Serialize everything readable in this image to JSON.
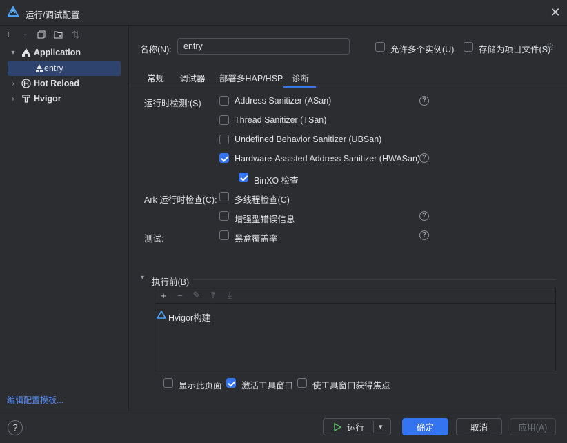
{
  "window": {
    "title": "运行/调试配置",
    "close_icon": "close-icon"
  },
  "toolbar": {
    "icons": [
      "add-icon",
      "remove-icon",
      "copy-icon",
      "folder-add-icon",
      "sort-icon"
    ]
  },
  "tree": {
    "items": [
      {
        "label": "Application",
        "expanded": true,
        "icon": "harmony-app-icon"
      },
      {
        "label": "entry",
        "selected": true,
        "icon": "harmony-module-icon"
      },
      {
        "label": "Hot Reload",
        "expanded": false,
        "icon": "hot-reload-icon"
      },
      {
        "label": "Hvigor",
        "expanded": false,
        "icon": "hvigor-icon"
      }
    ],
    "edit_templates": "编辑配置模板..."
  },
  "form": {
    "name_label": "名称(N):",
    "name_value": "entry",
    "allow_multiple": {
      "label": "允许多个实例(U)",
      "checked": false
    },
    "store_as_file": {
      "label": "存储为项目文件(S)",
      "checked": false
    },
    "tabs": [
      "常规",
      "调试器",
      "部署多HAP/HSP",
      "诊断"
    ],
    "active_tab": "诊断"
  },
  "diagnostics": {
    "runtime_label": "运行时检测:(S)",
    "asan": {
      "label": "Address Sanitizer (ASan)",
      "checked": false
    },
    "tsan": {
      "label": "Thread Sanitizer (TSan)",
      "checked": false
    },
    "ubsan": {
      "label": "Undefined Behavior Sanitizer (UBSan)",
      "checked": false
    },
    "hwasan": {
      "label": "Hardware-Assisted Address Sanitizer (HWASan)",
      "checked": true
    },
    "binxo": {
      "label": "BinXO 检查",
      "checked": true
    },
    "ark_label": "Ark 运行时检查(C):",
    "multithread": {
      "label": "多线程检查(C)",
      "checked": false
    },
    "enhanced_errors": {
      "label": "增强型错误信息",
      "checked": false
    },
    "test_label": "测试:",
    "blackbox": {
      "label": "黑盒覆盖率",
      "checked": false
    }
  },
  "before_launch": {
    "label": "执行前(B)",
    "tools": [
      "add-icon",
      "remove-icon",
      "edit-icon",
      "move-up-icon",
      "move-down-icon"
    ],
    "tasks": [
      "Hvigor构建"
    ],
    "show_page": {
      "label": "显示此页面",
      "checked": false
    },
    "activate_tool_window": {
      "label": "激活工具窗口",
      "checked": true
    },
    "focus_tool_window": {
      "label": "使工具窗口获得焦点",
      "checked": false
    }
  },
  "footer": {
    "run": "运行",
    "ok": "确定",
    "cancel": "取消",
    "apply": "应用(A)"
  },
  "colors": {
    "accent": "#3574f0",
    "selection": "#2e436e",
    "link": "#548af7",
    "background": "#2b2d30"
  }
}
